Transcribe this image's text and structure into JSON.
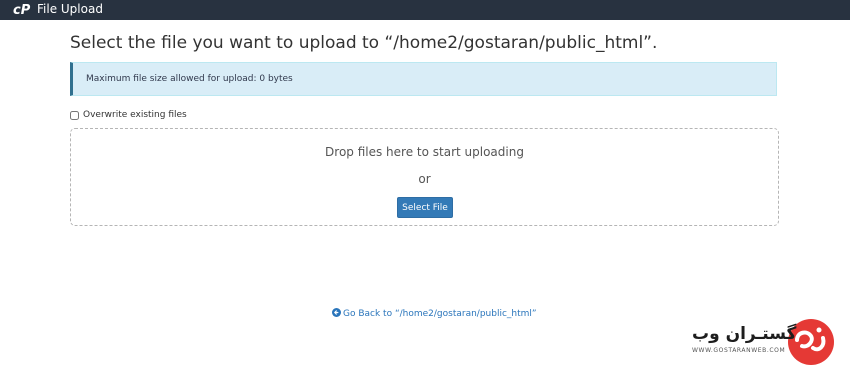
{
  "header": {
    "title": "File Upload",
    "logo_icon": "cpanel-logo-icon"
  },
  "page": {
    "heading": "Select the file you want to upload to “/home2/gostaran/public_html”."
  },
  "alert": {
    "text": "Maximum file size allowed for upload: 0 bytes"
  },
  "options": {
    "overwrite_label": "Overwrite existing files",
    "overwrite_checked": false
  },
  "dropzone": {
    "prompt": "Drop files here to start uploading",
    "or_text": "or",
    "select_button_label": "Select File"
  },
  "footer": {
    "back_link_text": "Go Back to “/home2/gostaran/public_html”",
    "back_icon": "arrow-left-circle-icon"
  },
  "watermark": {
    "brand_name": "گستـران وب",
    "brand_url": "WWW.GOSTARANWEB.COM"
  },
  "colors": {
    "topbar": "#283240",
    "primary_button": "#337ab7",
    "info_bg": "#d9edf7",
    "link": "#2a75bb",
    "brand_red": "#e53935"
  }
}
